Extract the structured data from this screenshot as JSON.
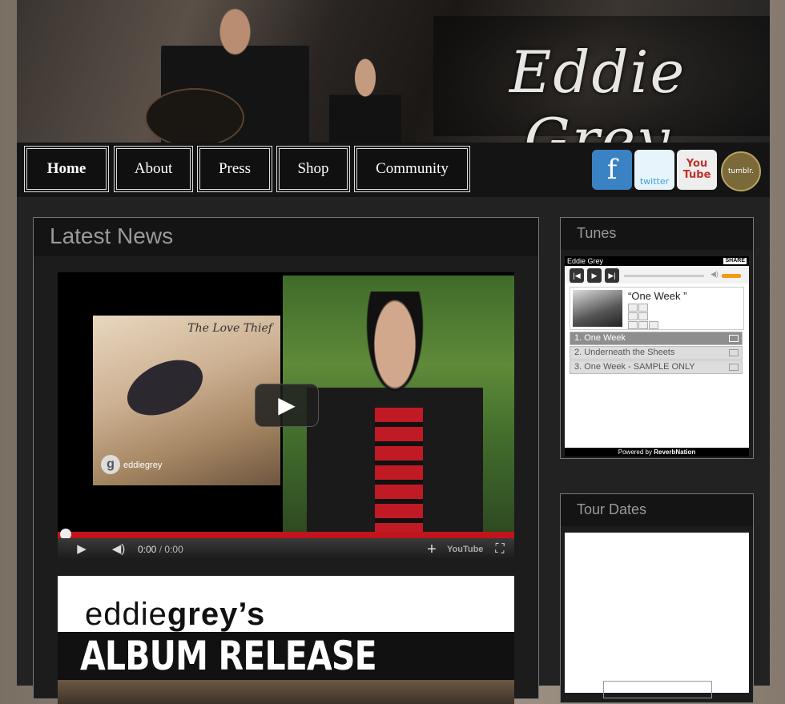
{
  "header": {
    "brand": "Eddie Grey"
  },
  "nav": {
    "items": [
      {
        "label": "Home",
        "active": true
      },
      {
        "label": "About",
        "active": false
      },
      {
        "label": "Press",
        "active": false
      },
      {
        "label": "Shop",
        "active": false
      },
      {
        "label": "Community",
        "active": false
      }
    ]
  },
  "social": {
    "facebook": "f",
    "twitter": "twitter",
    "youtube": "You Tube",
    "tumblr": "tumblr."
  },
  "colors": {
    "facebook": "#3b82c4",
    "twitter": "#5bb8e8",
    "youtube": "#d9534f",
    "tumblr": "#7a6a3a",
    "progress": "#c0151c"
  },
  "main": {
    "title": "Latest News",
    "video": {
      "album_title": "The Love Thief",
      "album_logo_letter": "g",
      "album_logo_text": "eddiegrey",
      "time_current": "0:00",
      "time_total": "0:00",
      "separator": "/",
      "youtube_label": "YouTube"
    },
    "banner": {
      "line1_light": "eddie",
      "line1_bold": "grey’s",
      "line2": "ALBUM RELEASE PARTY!"
    }
  },
  "tunes": {
    "title": "Tunes",
    "artist": "Eddie Grey",
    "share": "SHARE",
    "now_playing": "“One Week ”",
    "tracks": [
      {
        "label": "1. One Week",
        "selected": true
      },
      {
        "label": "2. Underneath the Sheets",
        "selected": false
      },
      {
        "label": "3. One Week - SAMPLE ONLY",
        "selected": false
      }
    ],
    "powered_prefix": "Powered by",
    "powered_brand": "ReverbNation"
  },
  "tour": {
    "title": "Tour Dates"
  }
}
